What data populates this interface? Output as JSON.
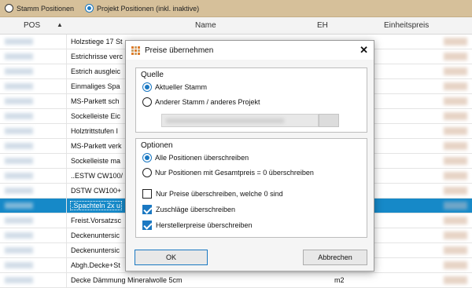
{
  "topbar": {
    "options": [
      "Stamm Positionen",
      "Projekt Positionen (inkl. inaktive)"
    ]
  },
  "grid": {
    "columns": {
      "pos": "POS",
      "name": "Name",
      "eh": "EH",
      "price": "Einheitspreis"
    },
    "rows": [
      {
        "name": "Holzstiege 17 St",
        "eh": "",
        "selected": false
      },
      {
        "name": "Estrichrisse verc",
        "eh": "",
        "selected": false
      },
      {
        "name": "Estrich ausgleic",
        "eh": "",
        "selected": false
      },
      {
        "name": "Einmaliges Spa",
        "eh": "",
        "selected": false
      },
      {
        "name": "MS-Parkett sch",
        "eh": "",
        "selected": false
      },
      {
        "name": "Sockelleiste Eic",
        "eh": "",
        "selected": false
      },
      {
        "name": "Holztrittstufen I",
        "eh": "",
        "selected": false
      },
      {
        "name": "MS-Parkett verk",
        "eh": "",
        "selected": false
      },
      {
        "name": "Sockelleiste ma",
        "eh": "",
        "selected": false
      },
      {
        "name": "..ESTW CW100/",
        "eh": "",
        "selected": false
      },
      {
        "name": "DSTW CW100+",
        "eh": "",
        "selected": false
      },
      {
        "name": ".Spachteln 2x u",
        "eh": "",
        "selected": true
      },
      {
        "name": "Freist.Vorsatzsc",
        "eh": "",
        "selected": false
      },
      {
        "name": "Deckenuntersic",
        "eh": "",
        "selected": false
      },
      {
        "name": "Deckenuntersic",
        "eh": "",
        "selected": false
      },
      {
        "name": "Abgh.Decke+St",
        "eh": "",
        "selected": false
      },
      {
        "name": "Decke Dämmung Mineralwolle 5cm",
        "eh": "m2",
        "selected": false
      }
    ]
  },
  "dialog": {
    "title": "Preise übernehmen",
    "quelle": {
      "legend": "Quelle",
      "options": [
        "Aktueller Stamm",
        "Anderer Stamm / anderes Projekt"
      ]
    },
    "optionen": {
      "legend": "Optionen",
      "radios": [
        "Alle Positionen überschreiben",
        "Nur Positionen mit Gesamtpreis = 0 überschreiben"
      ],
      "checks": [
        {
          "label": "Nur Preise überschreiben, welche 0 sind",
          "checked": false
        },
        {
          "label": "Zuschläge überschreiben",
          "checked": true
        },
        {
          "label": "Herstellerpreise überschreiben",
          "checked": true
        }
      ]
    },
    "ok_label": "OK",
    "cancel_label": "Abbrechen"
  },
  "colors": {
    "accent": "#1a78c2",
    "selection": "#1689c8",
    "topbar": "#d6c09a"
  }
}
